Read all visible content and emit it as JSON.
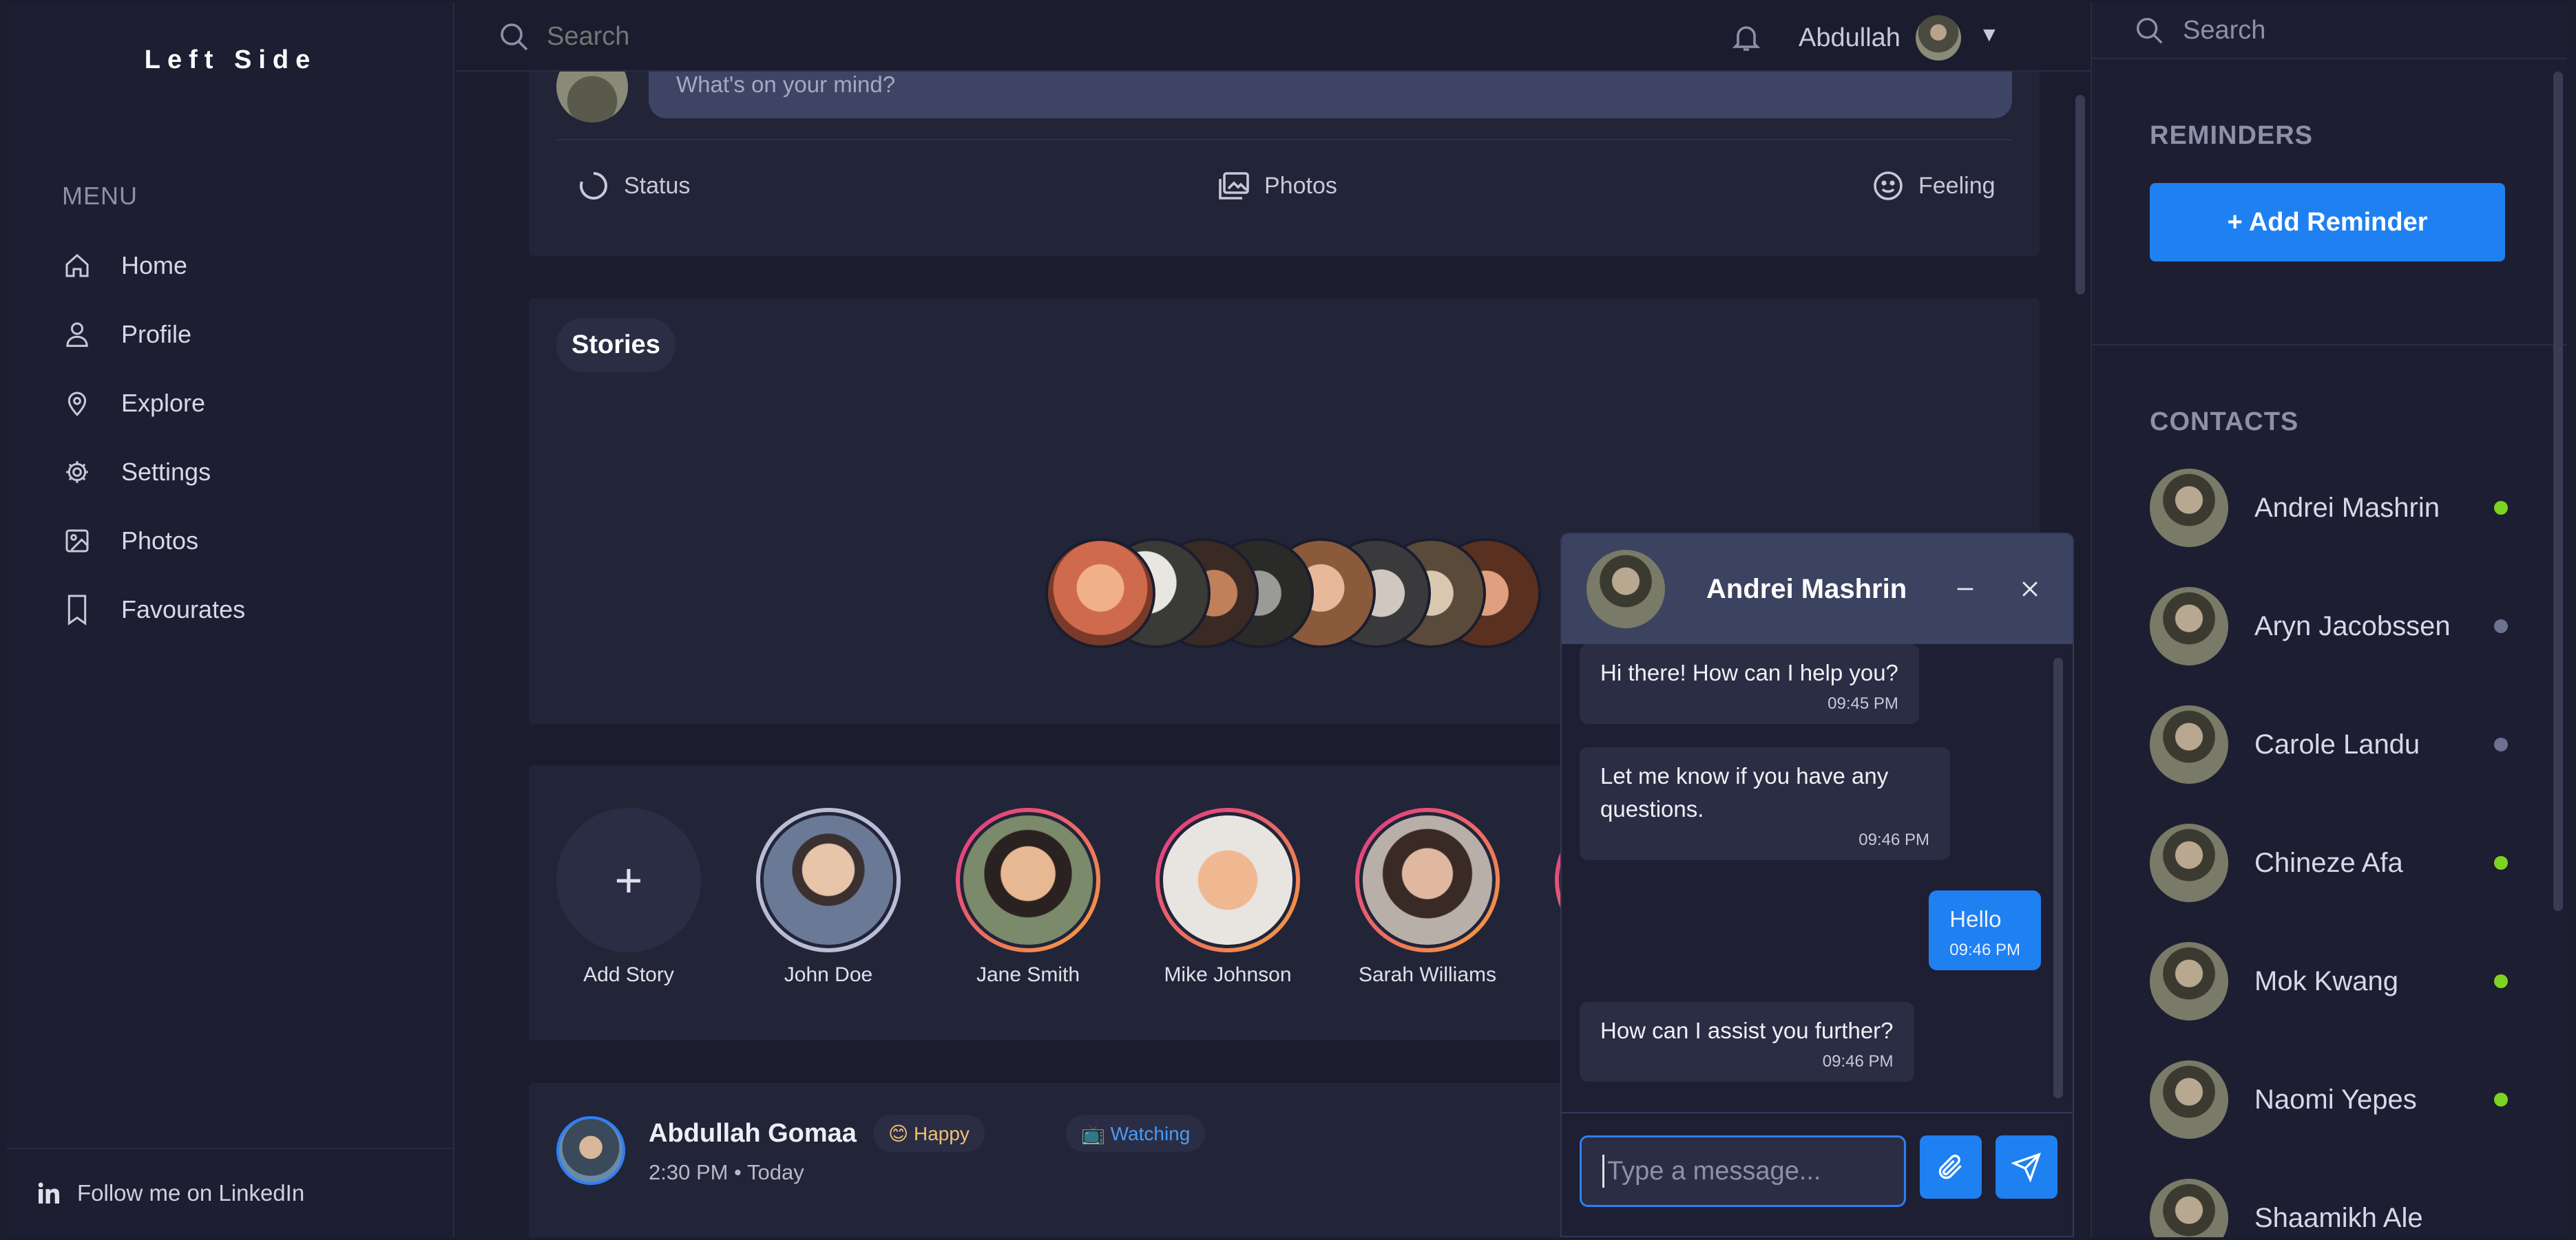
{
  "brand": "Left Side",
  "menu": {
    "title": "MENU",
    "items": [
      {
        "label": "Home",
        "icon": "home-icon"
      },
      {
        "label": "Profile",
        "icon": "user-icon"
      },
      {
        "label": "Explore",
        "icon": "location-pin-icon"
      },
      {
        "label": "Settings",
        "icon": "gear-icon"
      },
      {
        "label": "Photos",
        "icon": "image-icon"
      },
      {
        "label": "Favourates",
        "icon": "bookmark-icon"
      }
    ]
  },
  "sidebar_footer": {
    "label": "Follow me on LinkedIn",
    "icon": "linkedin-icon"
  },
  "topbar": {
    "search_placeholder": "Search",
    "user_name": "Abdullah",
    "caret": "▼"
  },
  "composer": {
    "placeholder": "What's on your mind?",
    "actions": [
      {
        "label": "Status",
        "icon": "status-ring-icon"
      },
      {
        "label": "Photos",
        "icon": "photos-icon"
      },
      {
        "label": "Feeling",
        "icon": "smiley-icon"
      }
    ]
  },
  "stories": {
    "title": "Stories"
  },
  "story_row": {
    "add_label": "Add Story",
    "add_symbol": "+",
    "people": [
      "John Doe",
      "Jane Smith",
      "Mike Johnson",
      "Sarah Williams"
    ]
  },
  "post": {
    "author": "Abdullah Gomaa",
    "mood": "😊 Happy",
    "activity": "📺 Watching",
    "time": "2:30 PM • Today"
  },
  "right_panel": {
    "search_placeholder": "Search",
    "reminders_title": "REMINDERS",
    "add_reminder": "+  Add Reminder",
    "contacts_title": "CONTACTS",
    "contacts": [
      {
        "name": "Andrei Mashrin",
        "status": "online"
      },
      {
        "name": "Aryn Jacobssen",
        "status": "offline"
      },
      {
        "name": "Carole Landu",
        "status": "offline"
      },
      {
        "name": "Chineze Afa",
        "status": "online"
      },
      {
        "name": "Mok Kwang",
        "status": "online"
      },
      {
        "name": "Naomi Yepes",
        "status": "online"
      },
      {
        "name": "Shaamikh Ale",
        "status": "online"
      }
    ]
  },
  "chat": {
    "title": "Andrei Mashrin",
    "minimize": "—",
    "close": "✕",
    "messages": [
      {
        "text": "Hi there! How can I help you?",
        "time": "09:45 PM",
        "from": "them"
      },
      {
        "text": "Let me know if you have any questions.",
        "time": "09:46 PM",
        "from": "them"
      },
      {
        "text": "Hello",
        "time": "09:46 PM",
        "from": "me"
      },
      {
        "text": "How can I assist you further?",
        "time": "09:46 PM",
        "from": "them"
      }
    ],
    "input_placeholder": "Type a message..."
  },
  "colors": {
    "background": "#1b1c2e",
    "card": "#222438",
    "accent": "#1f80f2",
    "online": "#7ed321",
    "offline": "#6c7290"
  }
}
